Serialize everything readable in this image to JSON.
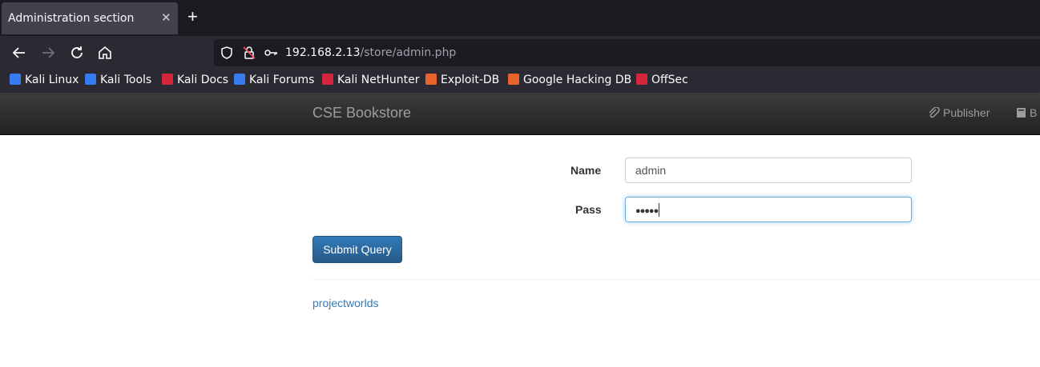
{
  "browser": {
    "tab_title": "Administration section",
    "tab_close": "✕",
    "new_tab": "+",
    "url_host": "192.168.2.13",
    "url_path": "/store/admin.php"
  },
  "bookmarks": [
    {
      "label": "Kali Linux",
      "color": "#367bf0"
    },
    {
      "label": "Kali Tools",
      "color": "#367bf0"
    },
    {
      "label": "Kali Docs",
      "color": "#d3253b"
    },
    {
      "label": "Kali Forums",
      "color": "#367bf0"
    },
    {
      "label": "Kali NetHunter",
      "color": "#d3253b"
    },
    {
      "label": "Exploit-DB",
      "color": "#e8632b"
    },
    {
      "label": "Google Hacking DB",
      "color": "#e8632b"
    },
    {
      "label": "OffSec",
      "color": "#d3253b"
    }
  ],
  "site": {
    "brand": "CSE Bookstore",
    "nav_publisher": "Publisher",
    "nav_books": "B"
  },
  "form": {
    "name_label": "Name",
    "name_value": "admin",
    "pass_label": "Pass",
    "pass_value": "●●●●●",
    "submit_label": "Submit Query"
  },
  "footer": {
    "link": "projectworlds"
  }
}
